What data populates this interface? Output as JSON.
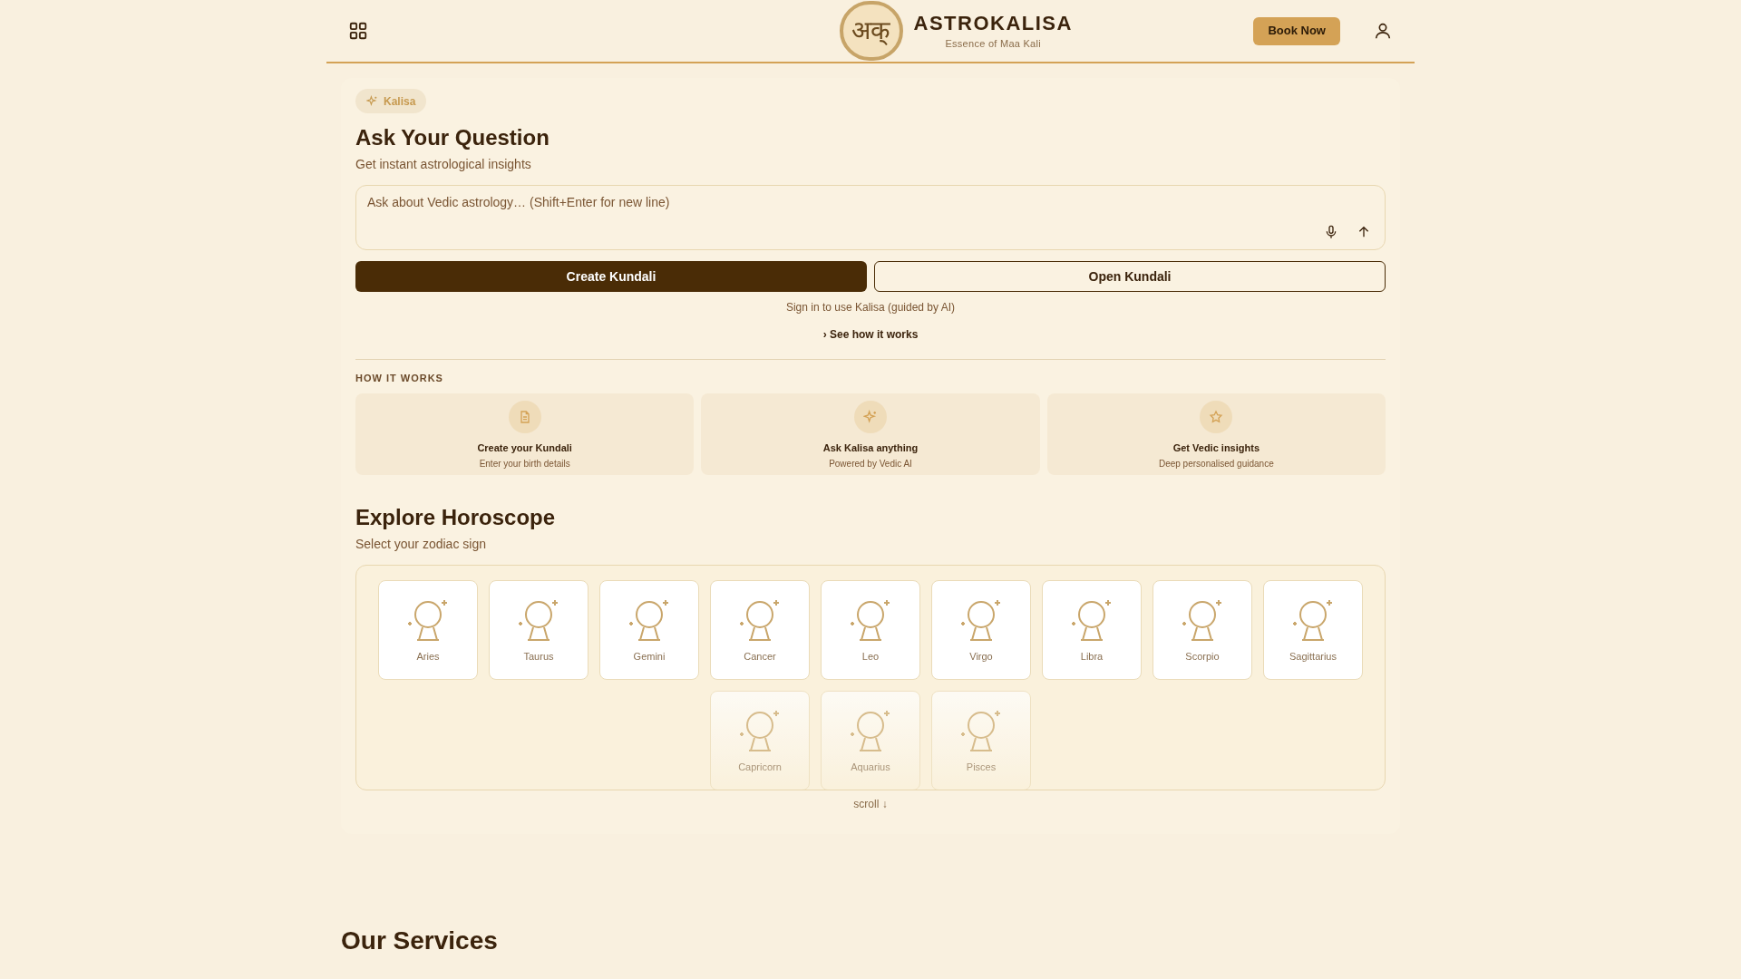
{
  "header": {
    "logo_mark": "अक्",
    "brand": "ASTROKALISA",
    "tagline": "Essence of Maa Kali",
    "book_button": "Book Now"
  },
  "ask": {
    "badge": "Kalisa",
    "title": "Ask Your Question",
    "subtitle": "Get instant astrological insights",
    "input": {
      "placeholder": "Ask about Vedic astrology… (Shift+Enter for new line)"
    },
    "buttons": [
      {
        "label": "Create Kundali",
        "kind": "primary"
      },
      {
        "label": "Open Kundali",
        "kind": "outline"
      }
    ],
    "sign_in_note": "Sign in to use Kalisa (guided by AI)",
    "see_how_link": "› See how it works"
  },
  "how_it_works": {
    "heading": "HOW IT WORKS",
    "steps": [
      {
        "kind": "document",
        "title": "Create your Kundali",
        "subtitle": "Enter your birth details"
      },
      {
        "kind": "sparkle",
        "title": "Ask Kalisa anything",
        "subtitle": "Powered by Vedic AI"
      },
      {
        "kind": "star",
        "title": "Get Vedic insights",
        "subtitle": "Deep personalised guidance"
      }
    ]
  },
  "horoscope": {
    "title": "Explore Horoscope",
    "subtitle": "Select your zodiac sign",
    "signs": [
      {
        "name": "Aries",
        "faded": false
      },
      {
        "name": "Taurus",
        "faded": false
      },
      {
        "name": "Gemini",
        "faded": false
      },
      {
        "name": "Cancer",
        "faded": false
      },
      {
        "name": "Leo",
        "faded": false
      },
      {
        "name": "Virgo",
        "faded": false
      },
      {
        "name": "Libra",
        "faded": false
      },
      {
        "name": "Scorpio",
        "faded": false
      },
      {
        "name": "Sagittarius",
        "faded": false
      },
      {
        "name": "Capricorn",
        "faded": true
      },
      {
        "name": "Aquarius",
        "faded": true
      },
      {
        "name": "Pisces",
        "faded": true
      }
    ],
    "scroll_hint": "scroll ↓"
  },
  "services": {
    "title": "Our Services"
  }
}
